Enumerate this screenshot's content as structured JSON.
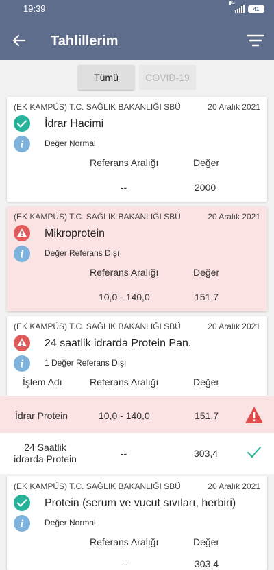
{
  "status_bar": {
    "time": "19:39",
    "network": "4G",
    "battery": "41"
  },
  "header": {
    "title": "Tahlillerim",
    "back_icon": "arrow-left-icon",
    "filter_icon": "filter-icon"
  },
  "tabs": [
    {
      "label": "Tümü",
      "active": true
    },
    {
      "label": "COVID-19",
      "active": false
    }
  ],
  "colors": {
    "header_bg": "#5e6d8c",
    "ok_green": "#26b39a",
    "alert_red": "#e05b5b",
    "info_blue": "#7db3dc",
    "alert_bg": "#fbe3e3"
  },
  "cards": [
    {
      "hospital": "(EK KAMPÜS) T.C. SAĞLIK BAKANLIĞI SBÜ",
      "date": "20 Aralık 2021",
      "test_name": "İdrar Hacimi",
      "note": "Değer Normal",
      "ref_header": "Referans Aralığı",
      "value_header": "Değer",
      "ref_value": "--",
      "value": "2000",
      "status": "normal"
    },
    {
      "hospital": "(EK KAMPÜS) T.C. SAĞLIK BAKANLIĞI SBÜ",
      "date": "20 Aralık 2021",
      "test_name": "Mikroprotein",
      "note": "Değer Referans Dışı",
      "ref_header": "Referans Aralığı",
      "value_header": "Değer",
      "ref_value": "10,0 - 140,0",
      "value": "151,7",
      "status": "out_of_range"
    },
    {
      "hospital": "(EK KAMPÜS) T.C. SAĞLIK BAKANLIĞI SBÜ",
      "date": "20 Aralık 2021",
      "test_name": "24 saatlik idrarda Protein Pan.",
      "note": "1 Değer Referans Dışı",
      "name_header": "İşlem Adı",
      "ref_header": "Referans Aralığı",
      "value_header": "Değer",
      "status": "out_of_range",
      "rows": [
        {
          "name": "İdrar Protein",
          "ref": "10,0 - 140,0",
          "value": "151,7",
          "status": "out_of_range"
        },
        {
          "name": "24 Saatlik idrarda  Protein",
          "ref": "--",
          "value": "303,4",
          "status": "normal"
        }
      ]
    },
    {
      "hospital": "(EK KAMPÜS) T.C. SAĞLIK BAKANLIĞI SBÜ",
      "date": "20 Aralık 2021",
      "test_name": "Protein (serum ve vucut sıvıları, herbiri)",
      "note": "Değer Normal",
      "ref_header": "Referans Aralığı",
      "value_header": "Değer",
      "ref_value": "--",
      "value": "303,4",
      "status": "normal"
    }
  ]
}
